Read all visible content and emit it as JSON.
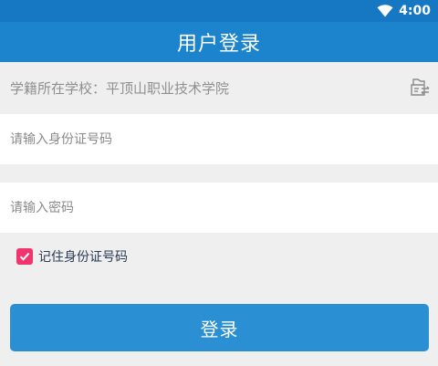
{
  "status_bar": {
    "time": "4:00",
    "wifi_icon": "wifi-icon"
  },
  "header": {
    "title": "用户登录"
  },
  "school": {
    "label": "学籍所在学校：",
    "value": "平顶山职业技术学院",
    "switch_icon": "switch-school-icon"
  },
  "form": {
    "id_placeholder": "请输入身份证号码",
    "id_value": "",
    "password_placeholder": "请输入密码",
    "password_value": "",
    "remember_label": "记住身份证号码",
    "remember_checked": true
  },
  "actions": {
    "login_label": "登录"
  },
  "colors": {
    "status_bar": "#1677c2",
    "app_bar": "#1b84cc",
    "button": "#2b8fd4",
    "checkbox": "#f0356e",
    "background": "#efefef"
  }
}
